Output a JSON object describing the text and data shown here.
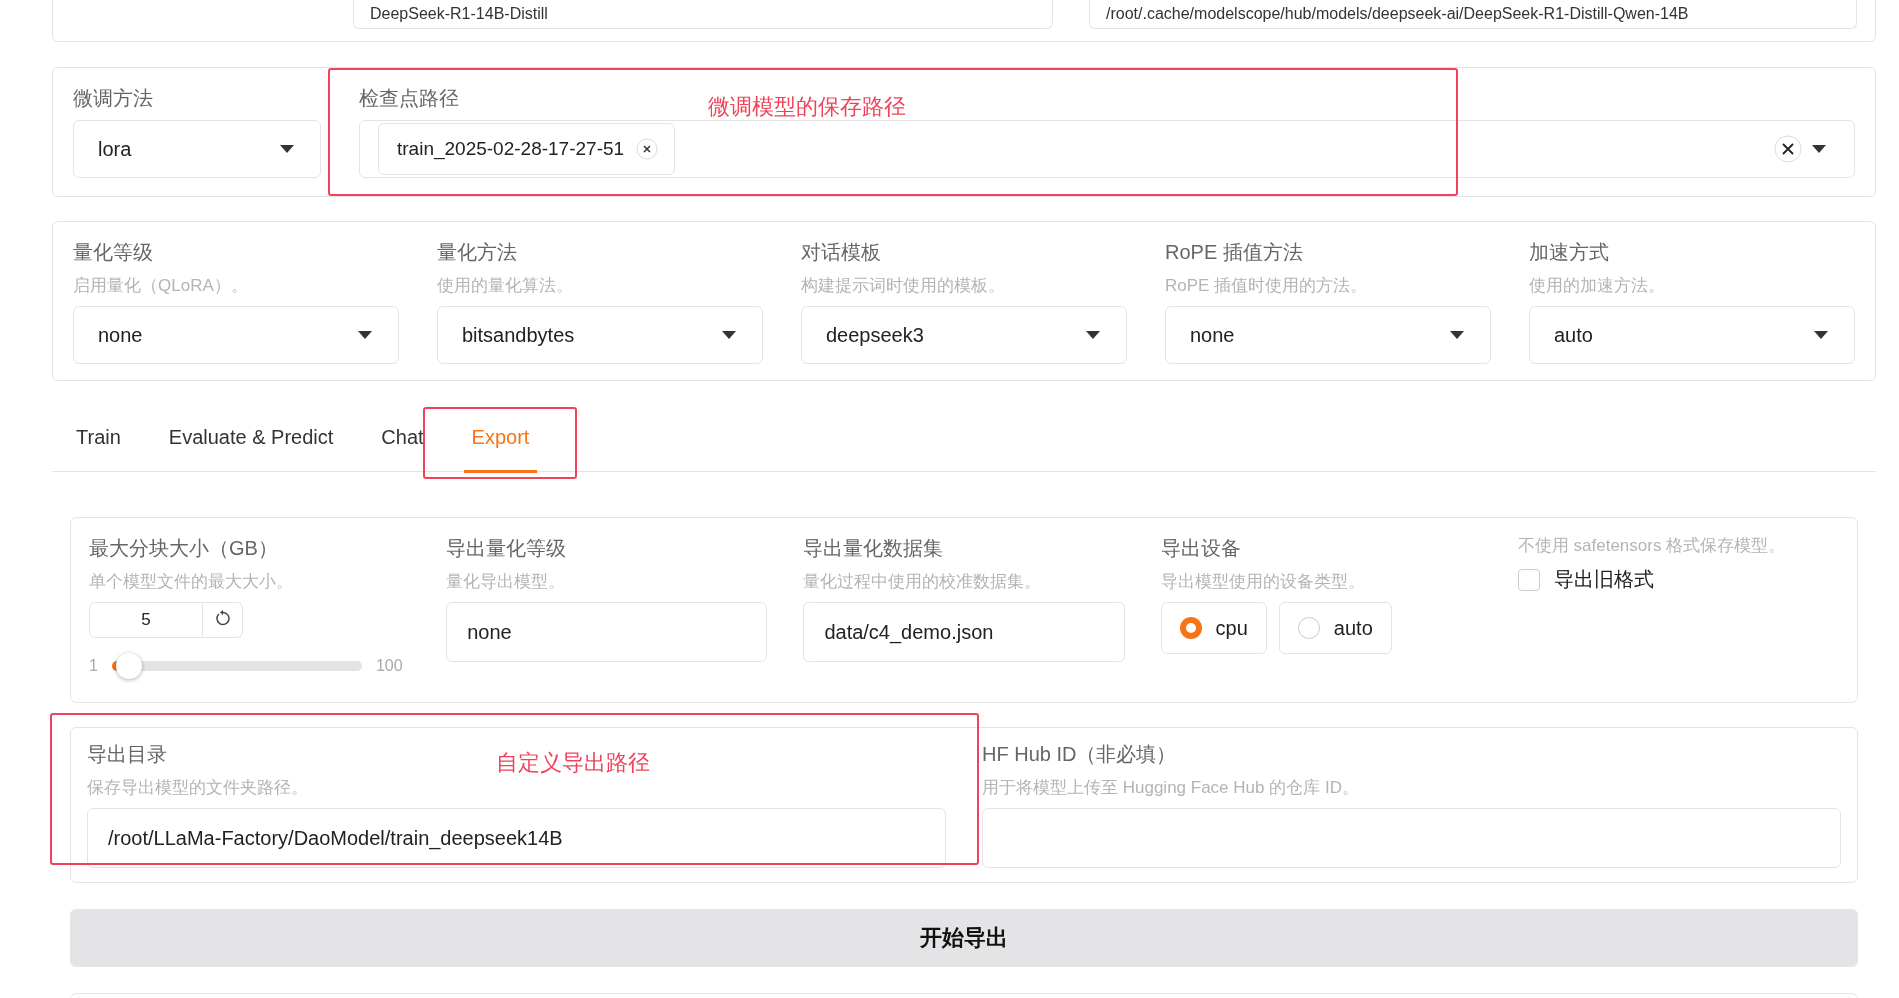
{
  "top_row": {
    "fields": [
      {
        "value": "DeepSeek-R1-14B-Distill"
      },
      {
        "value": "/root/.cache/modelscope/hub/models/deepseek-ai/DeepSeek-R1-Distill-Qwen-14B"
      }
    ]
  },
  "finetune": {
    "method": {
      "label": "微调方法",
      "value": "lora"
    },
    "checkpoint": {
      "label": "检查点路径",
      "tags": [
        "train_2025-02-28-17-27-51"
      ]
    }
  },
  "advanced": [
    {
      "label": "量化等级",
      "hint": "启用量化（QLoRA）。",
      "value": "none"
    },
    {
      "label": "量化方法",
      "hint": "使用的量化算法。",
      "value": "bitsandbytes"
    },
    {
      "label": "对话模板",
      "hint": "构建提示词时使用的模板。",
      "value": "deepseek3"
    },
    {
      "label": "RoPE 插值方法",
      "hint": "RoPE 插值时使用的方法。",
      "value": "none"
    },
    {
      "label": "加速方式",
      "hint": "使用的加速方法。",
      "value": "auto"
    }
  ],
  "tabs": [
    {
      "label": "Train",
      "selected": false
    },
    {
      "label": "Evaluate & Predict",
      "selected": false
    },
    {
      "label": "Chat",
      "selected": false
    },
    {
      "label": "Export",
      "selected": true
    }
  ],
  "export": {
    "max_shard": {
      "label": "最大分块大小（GB）",
      "hint": "单个模型文件的最大大小。",
      "value": "5",
      "min": "1",
      "max": "100",
      "level": 0.04
    },
    "quant_bit": {
      "label": "导出量化等级",
      "hint": "量化导出模型。",
      "value": "none"
    },
    "quant_dataset": {
      "label": "导出量化数据集",
      "hint": "量化过程中使用的校准数据集。",
      "value": "data/c4_demo.json"
    },
    "device": {
      "label": "导出设备",
      "hint": "导出模型使用的设备类型。",
      "options": [
        {
          "label": "cpu",
          "selected": true
        },
        {
          "label": "auto",
          "selected": false
        }
      ]
    },
    "legacy": {
      "hint": "不使用 safetensors 格式保存模型。",
      "label": "导出旧格式",
      "checked": false
    }
  },
  "output": {
    "export_dir": {
      "label": "导出目录",
      "hint": "保存导出模型的文件夹路径。",
      "value": "/root/LLaMa-Factory/DaoModel/train_deepseek14B"
    },
    "hub_id": {
      "label": "HF Hub ID（非必填）",
      "hint": "用于将模型上传至 Hugging Face Hub 的仓库 ID。"
    }
  },
  "start_button": "开始导出",
  "annotations": [
    {
      "kind": "labeled_box",
      "text": "微调模型的保存路径"
    },
    {
      "kind": "labeled_box",
      "text": "自定义导出路径"
    },
    {
      "kind": "box"
    }
  ]
}
